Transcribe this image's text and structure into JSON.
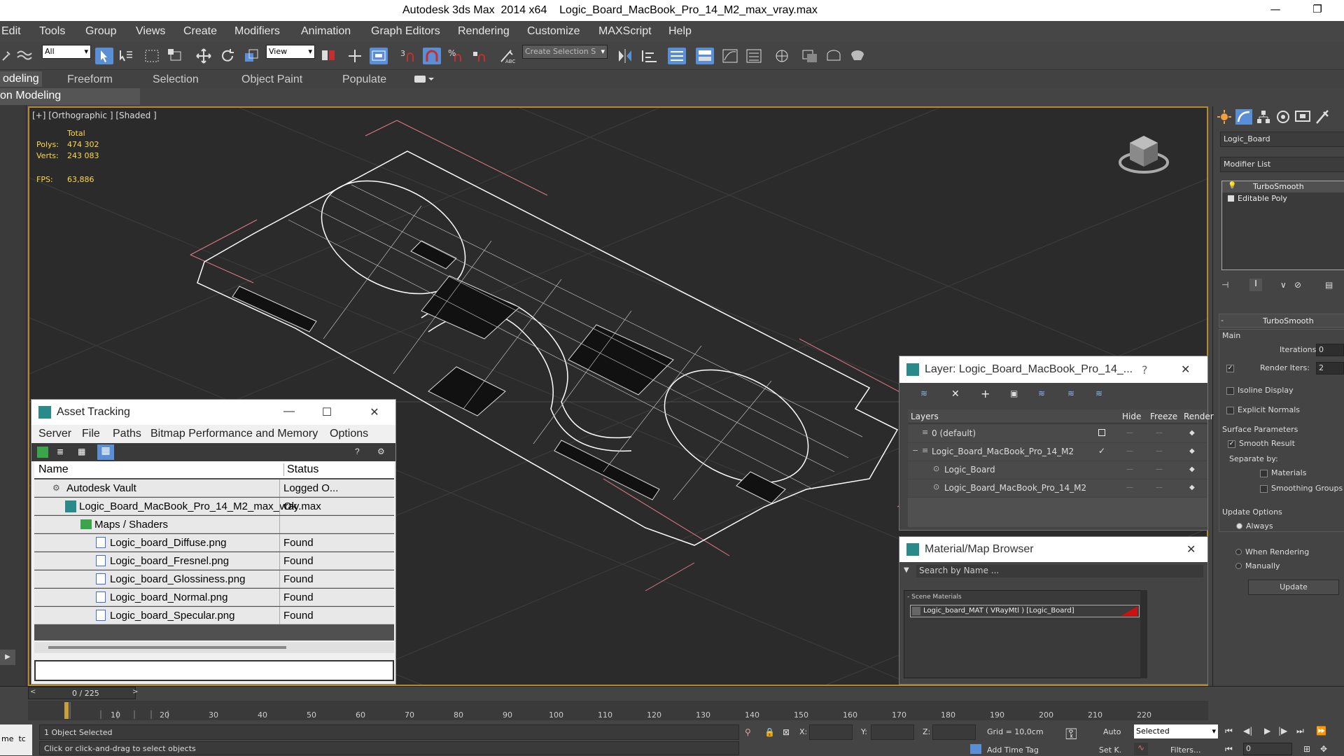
{
  "window": {
    "app_title": "Autodesk 3ds Max  2014 x64",
    "file_title": "Logic_Board_MacBook_Pro_14_M2_max_vray.max",
    "minimize": "—",
    "restore": "❐"
  },
  "menu": [
    "Edit",
    "Tools",
    "Group",
    "Views",
    "Create",
    "Modifiers",
    "Animation",
    "Graph Editors",
    "Rendering",
    "Customize",
    "MAXScript",
    "Help"
  ],
  "toolbar": {
    "selection_filter": "All",
    "reference_coord": "View",
    "named_selection": "Create Selection S"
  },
  "ribbon": {
    "tabs": [
      "odeling",
      "Freeform",
      "Selection",
      "Object Paint",
      "Populate"
    ],
    "sub_tab": "on Modeling"
  },
  "viewport": {
    "label": "[+] [Orthographic ] [Shaded ]",
    "stats": {
      "total_label": "Total",
      "polys_label": "Polys:",
      "polys": "474 302",
      "verts_label": "Verts:",
      "verts": "243 083",
      "fps_label": "FPS:",
      "fps": "63,886"
    }
  },
  "command_panel": {
    "object_name": "Logic_Board",
    "modifier_list": "Modifier List",
    "stack": [
      "TurboSmooth",
      "Editable Poly"
    ],
    "rollout_title": "TurboSmooth",
    "main_label": "Main",
    "iterations_label": "Iterations:",
    "iterations": "0",
    "render_iters_label": "Render Iters:",
    "render_iters": "2",
    "isoline": "Isoline Display",
    "explicit_normals": "Explicit Normals",
    "surface_params": "Surface Parameters",
    "smooth_result": "Smooth Result",
    "separate_by": "Separate by:",
    "materials": "Materials",
    "smoothing_groups": "Smoothing Groups",
    "update_options": "Update Options",
    "always": "Always",
    "when_rendering": "When Rendering",
    "manually": "Manually",
    "update_button": "Update"
  },
  "asset_tracking": {
    "title": "Asset Tracking",
    "menu": [
      "Server",
      "File",
      "Paths",
      "Bitmap Performance and Memory",
      "Options"
    ],
    "col_name": "Name",
    "col_status": "Status",
    "rows": [
      {
        "name": "Autodesk Vault",
        "status": "Logged O..."
      },
      {
        "name": "Logic_Board_MacBook_Pro_14_M2_max_vray.max",
        "status": "Ok"
      },
      {
        "name": "Maps / Shaders",
        "status": ""
      },
      {
        "name": "Logic_board_Diffuse.png",
        "status": "Found"
      },
      {
        "name": "Logic_board_Fresnel.png",
        "status": "Found"
      },
      {
        "name": "Logic_board_Glossiness.png",
        "status": "Found"
      },
      {
        "name": "Logic_board_Normal.png",
        "status": "Found"
      },
      {
        "name": "Logic_board_Specular.png",
        "status": "Found"
      }
    ]
  },
  "layer_window": {
    "title": "Layer: Logic_Board_MacBook_Pro_14_...",
    "help": "?",
    "col_layers": "Layers",
    "col_hide": "Hide",
    "col_freeze": "Freeze",
    "col_render": "Render",
    "rows": [
      {
        "name": "0 (default)"
      },
      {
        "name": "Logic_Board_MacBook_Pro_14_M2"
      },
      {
        "name": "Logic_Board"
      },
      {
        "name": "Logic_Board_MacBook_Pro_14_M2"
      }
    ]
  },
  "material_browser": {
    "title": "Material/Map Browser",
    "search_placeholder": "Search by Name ...",
    "section": "- Scene Materials",
    "material": "Logic_board_MAT ( VRayMtl ) [Logic_Board]"
  },
  "timeline": {
    "frame_counter": "0 / 225",
    "ticks": [
      "10",
      "20",
      "30",
      "40",
      "50",
      "60",
      "70",
      "80",
      "90",
      "100",
      "110",
      "120",
      "130",
      "140",
      "150",
      "160",
      "170",
      "180",
      "190",
      "200",
      "210",
      "220"
    ]
  },
  "status": {
    "selected_text": "1 Object Selected",
    "prompt": "Click or click-and-drag to select objects",
    "x_label": "X:",
    "y_label": "Y:",
    "z_label": "Z:",
    "grid": "Grid = 10,0cm",
    "add_time_tag": "Add Time Tag",
    "auto": "Auto",
    "set_key": "Set K.",
    "selected_dropdown": "Selected",
    "filters": "Filters...",
    "current_frame": "0",
    "maxscript_mini": "me  tc"
  },
  "colors": {
    "viewport_border": "#b58b2a",
    "wire": "#ffffff",
    "grid_line": "#444444",
    "stats_text": "#ffd84a",
    "material_swatch": "#cc1111"
  }
}
